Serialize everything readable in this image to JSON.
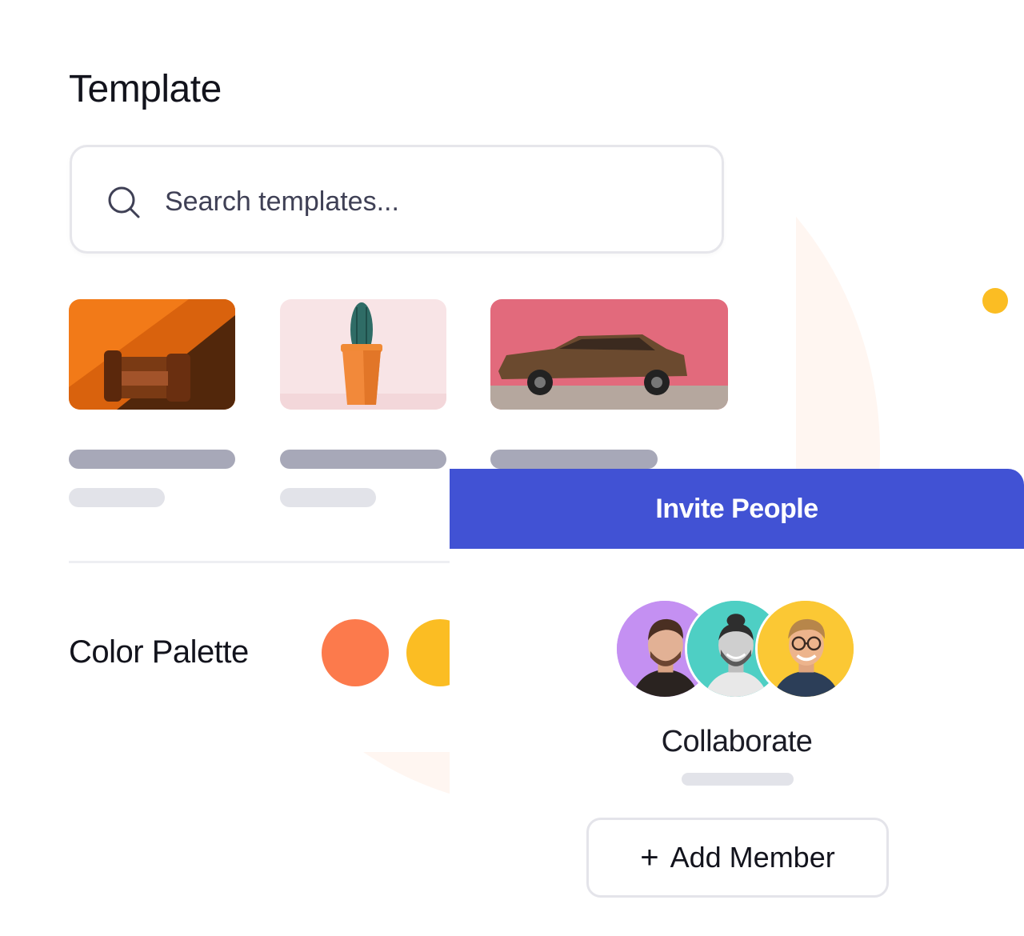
{
  "template": {
    "title": "Template",
    "search": {
      "placeholder": "Search templates...",
      "icon": "search-icon"
    },
    "thumbnails": [
      {
        "subject": "orange-armchair",
        "icon": "image"
      },
      {
        "subject": "cactus-pot",
        "icon": "image"
      },
      {
        "subject": "brown-car",
        "icon": "image"
      }
    ]
  },
  "palette": {
    "label": "Color Palette",
    "colors": [
      "#fc7a4c",
      "#fbbd23"
    ]
  },
  "invite": {
    "header": "Invite People",
    "avatar_colors": [
      "#c490f2",
      "#4ecfc4",
      "#fbc834"
    ],
    "title": "Collaborate",
    "add_button": {
      "icon": "plus-icon",
      "label": "Add Member"
    }
  },
  "colors": {
    "accent": "#4152d4",
    "decorative_dot": "#fbbd23"
  }
}
